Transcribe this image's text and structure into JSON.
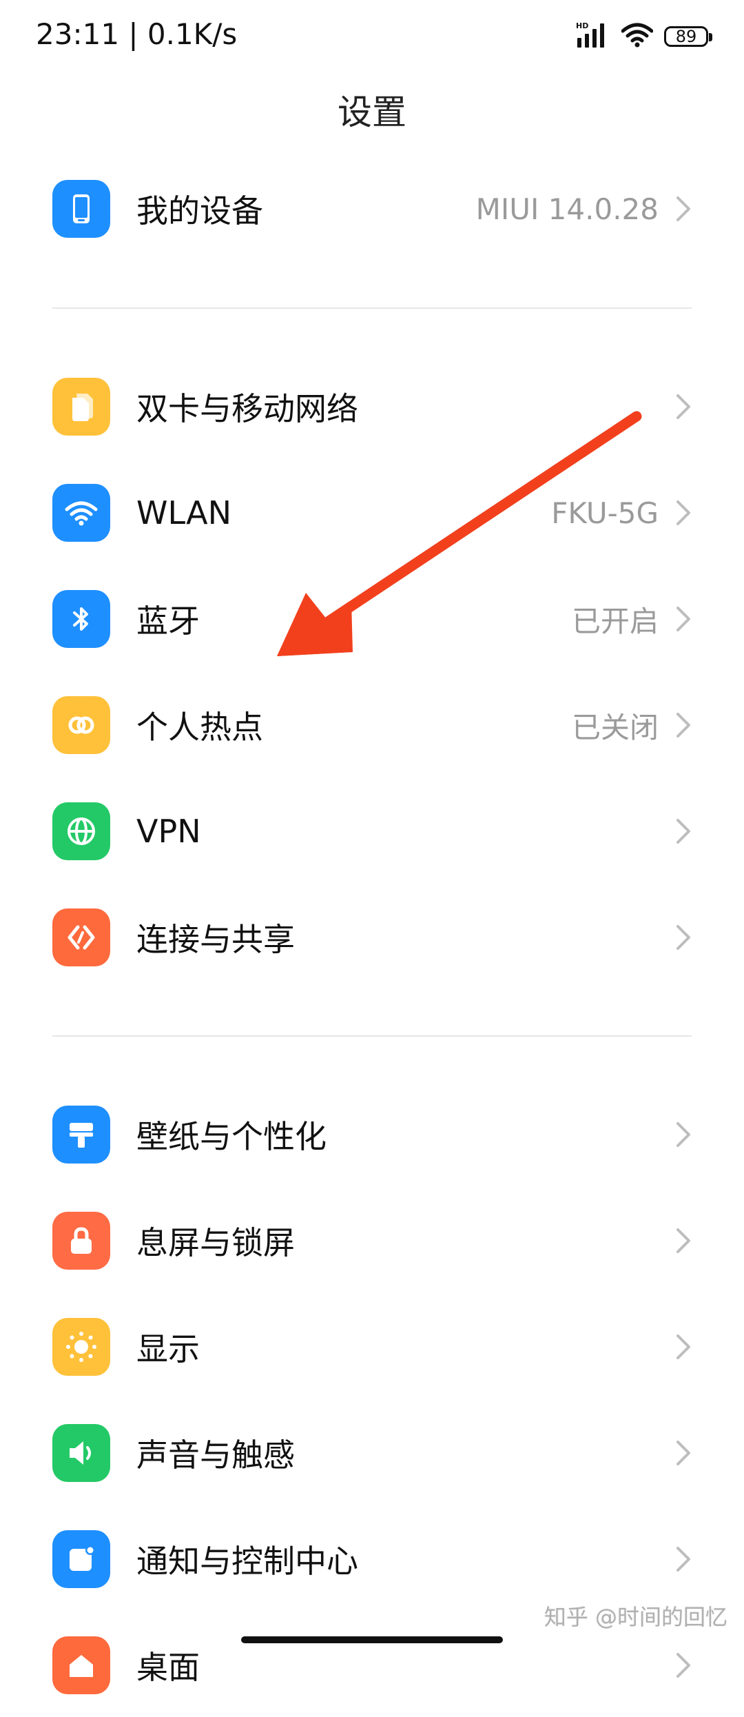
{
  "status_bar": {
    "time_speed": "23:11 | 0.1K/s",
    "battery": "89",
    "hd_label": "HD"
  },
  "header": {
    "title": "设置"
  },
  "groups": [
    {
      "items": [
        {
          "name": "my-device",
          "label": "我的设备",
          "value": "MIUI 14.0.28",
          "icon": "phone-icon",
          "color": "#1e8fff"
        }
      ]
    },
    {
      "items": [
        {
          "name": "sim-mobile-network",
          "label": "双卡与移动网络",
          "value": "",
          "icon": "sim-card-icon",
          "color": "#ffc13a"
        },
        {
          "name": "wlan",
          "label": "WLAN",
          "value": "FKU-5G",
          "icon": "wifi-icon",
          "color": "#1e8fff"
        },
        {
          "name": "bluetooth",
          "label": "蓝牙",
          "value": "已开启",
          "icon": "bluetooth-icon",
          "color": "#1e8fff"
        },
        {
          "name": "hotspot",
          "label": "个人热点",
          "value": "已关闭",
          "icon": "hotspot-icon",
          "color": "#ffc13a"
        },
        {
          "name": "vpn",
          "label": "VPN",
          "value": "",
          "icon": "globe-icon",
          "color": "#23c966"
        },
        {
          "name": "connection-sharing",
          "label": "连接与共享",
          "value": "",
          "icon": "share-icon",
          "color": "#ff6a3d"
        }
      ]
    },
    {
      "items": [
        {
          "name": "wallpaper",
          "label": "壁纸与个性化",
          "value": "",
          "icon": "brush-icon",
          "color": "#1e8fff"
        },
        {
          "name": "lock-screen",
          "label": "息屏与锁屏",
          "value": "",
          "icon": "lock-icon",
          "color": "#ff6b45"
        },
        {
          "name": "display",
          "label": "显示",
          "value": "",
          "icon": "sun-icon",
          "color": "#ffc13a"
        },
        {
          "name": "sound",
          "label": "声音与触感",
          "value": "",
          "icon": "speaker-icon",
          "color": "#23c966"
        },
        {
          "name": "notifications",
          "label": "通知与控制中心",
          "value": "",
          "icon": "notification-icon",
          "color": "#1e8fff"
        },
        {
          "name": "desktop",
          "label": "桌面",
          "value": "",
          "icon": "home-icon",
          "color": "#ff6a3d"
        }
      ]
    }
  ],
  "watermark": "知乎 @时间的回忆"
}
